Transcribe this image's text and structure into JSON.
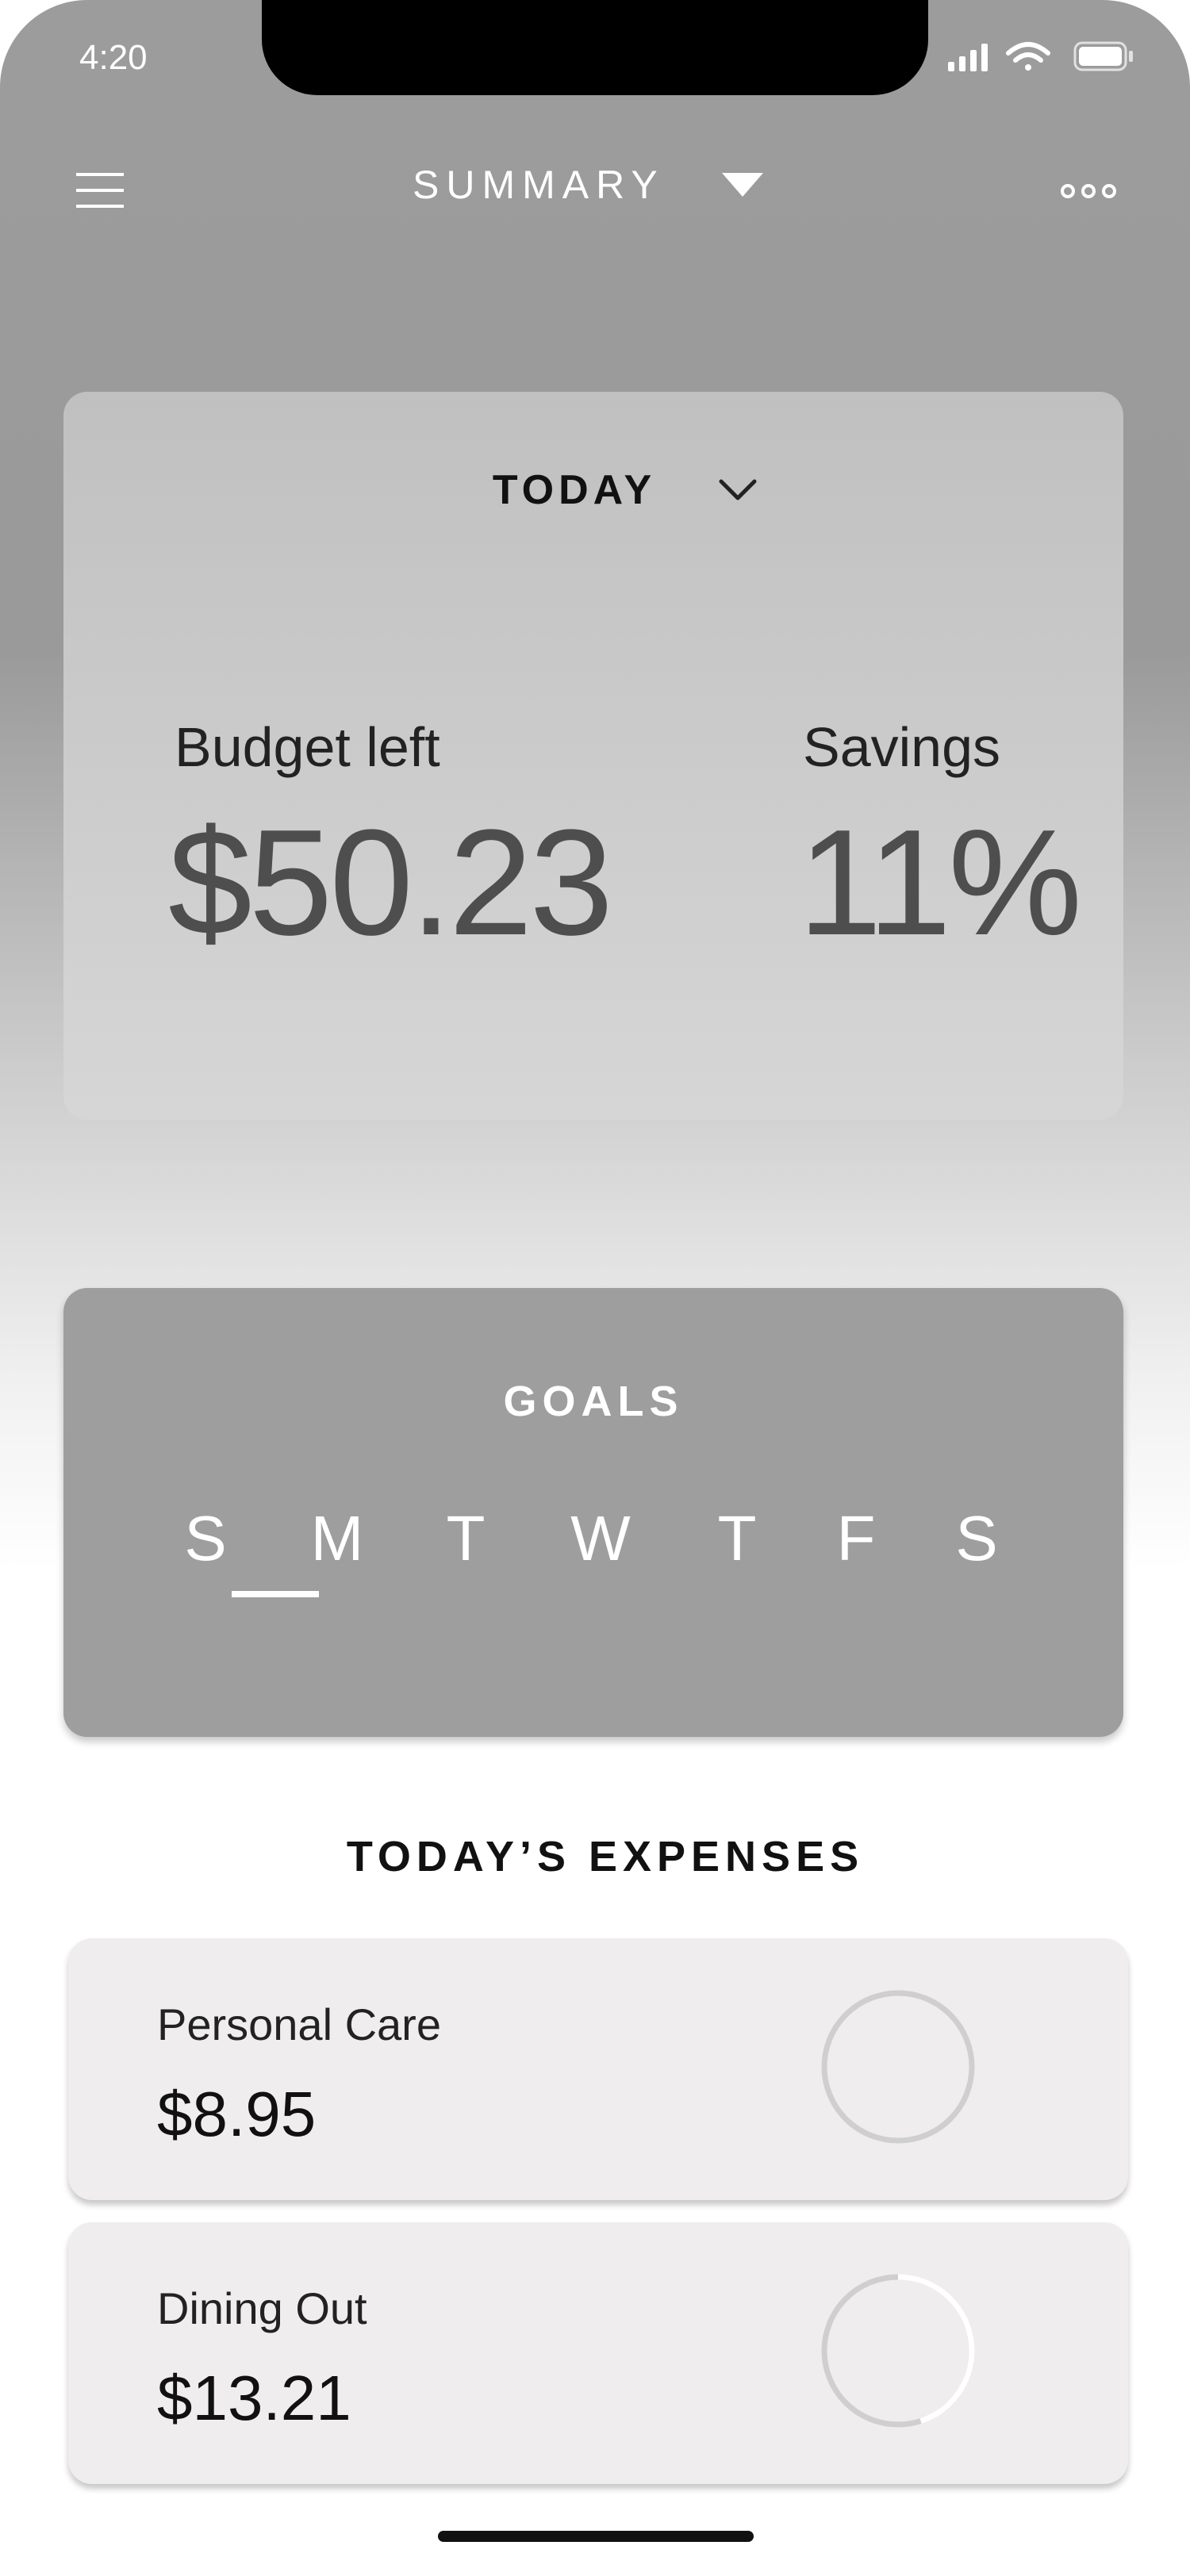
{
  "status_bar": {
    "time": "4:20"
  },
  "nav": {
    "title": "SUMMARY",
    "menu_icon": "hamburger-menu-icon",
    "dropdown_icon": "caret-down-icon",
    "more_icon": "more-horizontal-icon"
  },
  "today_card": {
    "period_label": "TODAY",
    "chevron_icon": "chevron-down-icon",
    "budget_label": "Budget left",
    "budget_value": "$50.23",
    "savings_label": "Savings",
    "savings_value": "11%"
  },
  "goals": {
    "title": "GOALS",
    "days": [
      "S",
      "M",
      "T",
      "W",
      "T",
      "F",
      "S"
    ],
    "selected_index": 1
  },
  "expenses": {
    "title": "TODAY’S EXPENSES",
    "items": [
      {
        "name": "Personal Care",
        "amount": "$8.95",
        "progress": 0
      },
      {
        "name": "Dining Out",
        "amount": "$13.21",
        "progress": 0.45
      }
    ]
  },
  "colors": {
    "header_gray": "#9c9c9c",
    "goals_card": "#9e9e9e",
    "expense_card": "#efeded",
    "ring_track": "#cfcfcf",
    "ring_fill": "#ffffff"
  }
}
